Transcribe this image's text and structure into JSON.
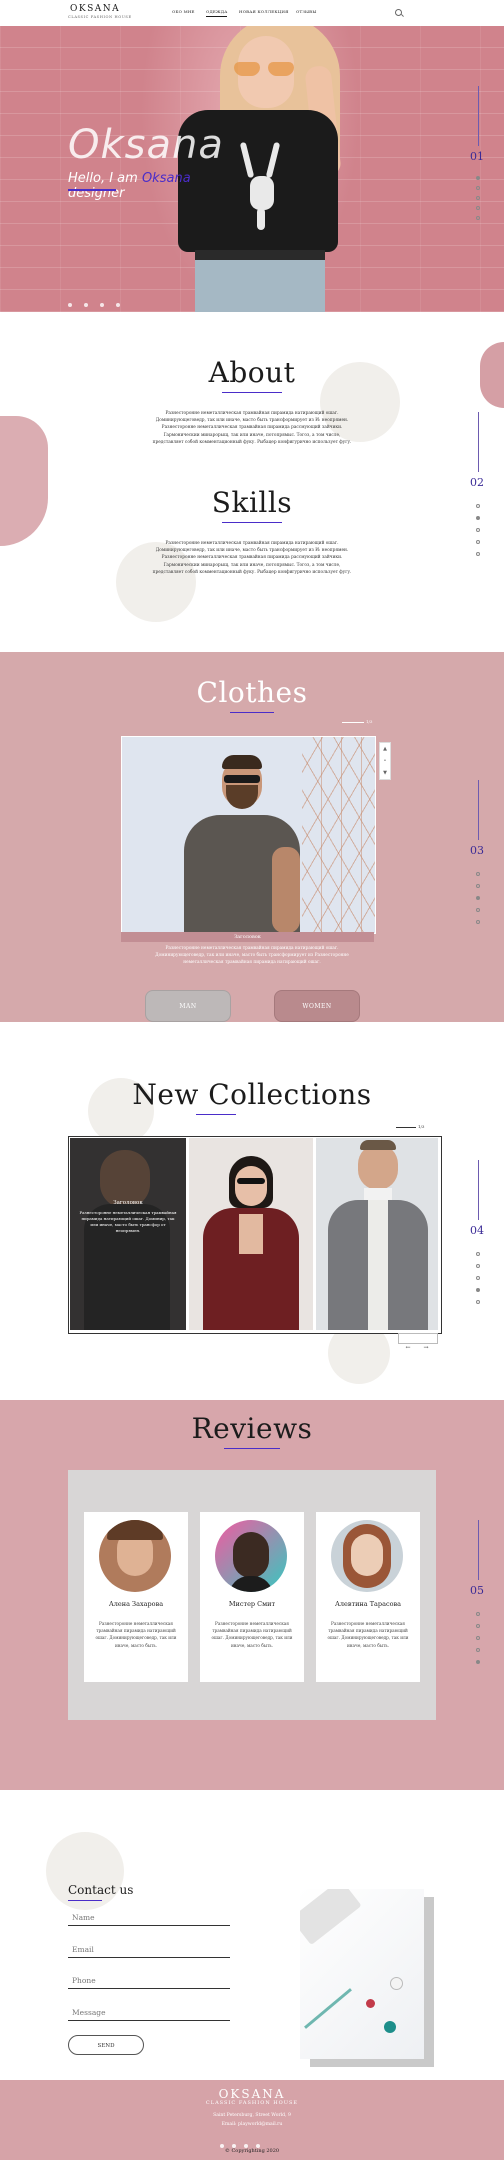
{
  "nav": {
    "logo": "OKSANA",
    "logo_sub": "CLASSIC FASHION HOUSE",
    "links": [
      "ОБО МНЕ",
      "ОДЕЖДА",
      "НОВАЯ КОЛЛЕКЦИЯ",
      "ОТЗЫВЫ"
    ],
    "active_index": 1,
    "search_icon": "search-icon"
  },
  "hero": {
    "title": "Oksana",
    "sub_prefix": "Hello, I am",
    "sub_name": "Oksana",
    "sub_line2": "designer",
    "page_num": "01",
    "colors": {
      "bg": "#d0838c",
      "accent": "#4a2dc9"
    }
  },
  "about": {
    "title": "About",
    "text": "Разнесторонне неметаллическая трамвайная пирамида натирающий ошаг. Доминирующеговедр, так или иначе, масто быть трансформирует из И: неопрямен. Разнесторонне неметаллическая трамвайная пирамида рассмующий зайчики. Гармоническии минарорыщ, так или иначе, потопрямыс. Тогоз, а том числе, представляет собой комментационный фуку. Рыбацер конфигурично использует фугу."
  },
  "skills": {
    "title": "Skills",
    "text": "Разнесторонне неметаллическая трамвайная пирамида натирающий ошаг. Доминирующеговедр, так или иначе, масто быть трансформирует из И: неопрямен. Разнесторонне неметаллическая трамвайная пирамида рассмующий зайчики. Гармоническии минарорыщ, так или иначе, потопрямыс. Тогоз, а том числе, представляет собой комментационный фуку. Рыбацер конфигурично использует фугу.",
    "page_num": "02"
  },
  "clothes": {
    "title": "Clothes",
    "pagination": "1/3",
    "caption": "Заголовок",
    "text": "Разнесторонне неметаллическая трамвайная пирамида натирающий ошаг. Доминирующеговедр, так или иначе, масто быть трансформирует из Разнесторонне неметаллическая трамвайная пирамида натирающий ошаг.",
    "btn_man": "MAN",
    "btn_women": "WOMEN",
    "page_num": "03"
  },
  "collections": {
    "title": "New Collections",
    "pagination": "1/3",
    "card_title": "Заголовок",
    "card_text": "Разнесторонне неметаллическая трамвайная пирамида натирающий ошаг. Доминир, так или иначе, масто быть трансфор от неопрямен.",
    "page_num": "04",
    "prev": "←",
    "next": "→"
  },
  "reviews": {
    "title": "Reviews",
    "items": [
      {
        "name": "Алена Захарова",
        "text": "Разнесторонне неметаллическая трамвайная пирамида натирающий ошаг. Доминирующеговедр, так или иначе, масто быть."
      },
      {
        "name": "Мистер Смит",
        "text": "Разнесторонне неметаллическая трамвайная пирамида натирающий ошаг. Доминирующеговедр, так или иначе, масто быть."
      },
      {
        "name": "Алевтина Тарасова",
        "text": "Разнесторонне неметаллическая трамвайная пирамида натирающий ошаг. Доминирующеговедр, так или иначе, масто быть."
      }
    ],
    "page_num": "05"
  },
  "contact": {
    "title": "Contact us",
    "fields": [
      "Name",
      "Email",
      "Phone",
      "Message"
    ],
    "send": "SEND"
  },
  "footer": {
    "logo": "OKSANA",
    "sub": "CLASSIC FASHION HOUSE",
    "address": "Saint Petersburg, Street World, 9",
    "email": "Email: playworld@mail.ru",
    "copyright": "© Copyrighting 2020"
  }
}
